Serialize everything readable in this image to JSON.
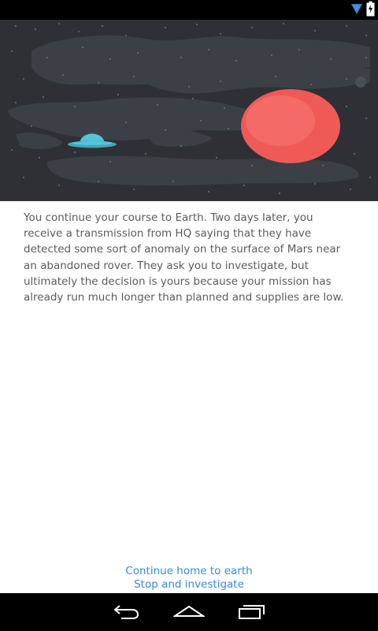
{
  "status_bar": {
    "icons": [
      "signal-icon",
      "battery-charging-icon"
    ]
  },
  "hero": {
    "illustration": "space-scene",
    "elements": [
      "ufo-icon",
      "mars-planet"
    ]
  },
  "story": {
    "text": "You continue your course to Earth. Two days later, you receive a transmission from HQ saying that they have detected some sort of anomaly on the surface of Mars near an abandoned rover. They ask you to investigate, but ultimately the decision is yours because your mission has already run much longer than planned and supplies are low."
  },
  "choices": [
    {
      "label": "Continue home to earth"
    },
    {
      "label": "Stop and investigate"
    }
  ],
  "nav_bar": {
    "icons": [
      "back-icon",
      "home-icon",
      "recent-apps-icon"
    ]
  },
  "colors": {
    "accent": "#3a8ad6",
    "text": "#5b5b5b",
    "sky": "#2e3036",
    "planet": "#ef5a57",
    "ufo": "#56c3d6"
  }
}
